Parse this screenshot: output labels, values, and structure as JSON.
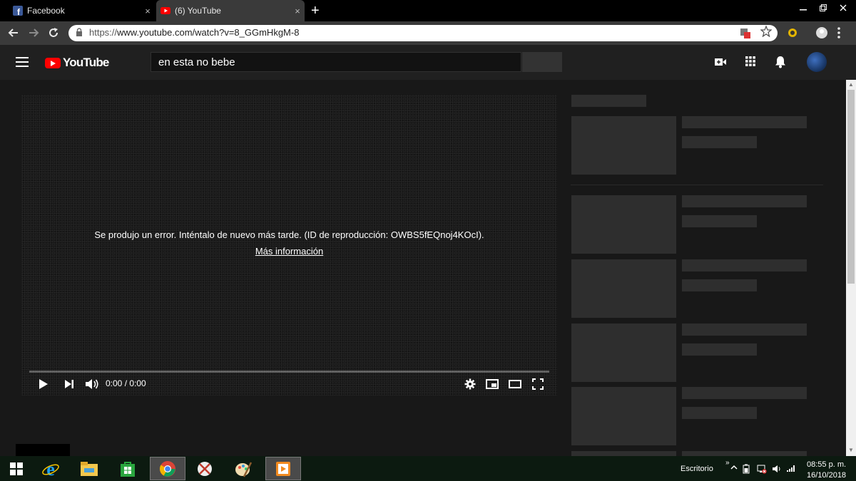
{
  "browser": {
    "tabs": [
      {
        "label": "Facebook",
        "icon": "facebook-icon",
        "active": false
      },
      {
        "label": "(6) YouTube",
        "icon": "youtube-icon",
        "active": true
      }
    ],
    "tab_close": "×",
    "new_tab": "+",
    "url_prefix": "https://",
    "url_rest": "www.youtube.com/watch?v=8_GGmHkgM-8"
  },
  "youtube": {
    "logo_text": "YouTube",
    "search_value": "en esta no bebe",
    "brand_color": "#ff0000"
  },
  "player": {
    "error_message": "Se produjo un error. Inténtalo de nuevo más tarde. (ID de reproducción: OWBS5fEQnoj4KOcI).",
    "more_info_link": "Más información",
    "time": "0:00 / 0:00"
  },
  "taskbar": {
    "desktop_label": "Escritorio",
    "time": "08:55 p. m.",
    "date": "16/10/2018"
  }
}
